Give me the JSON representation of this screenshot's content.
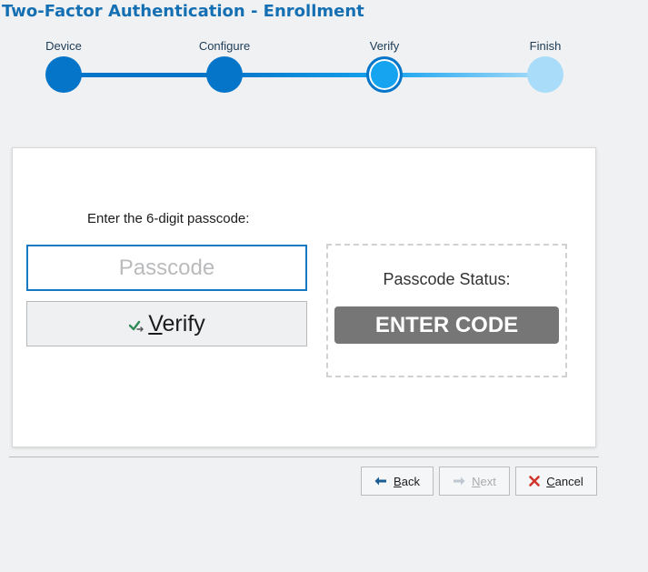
{
  "window": {
    "title": "Two-Factor Authentication - Enrollment"
  },
  "steps": [
    {
      "label": "Device",
      "state": "done"
    },
    {
      "label": "Configure",
      "state": "done"
    },
    {
      "label": "Verify",
      "state": "current"
    },
    {
      "label": "Finish",
      "state": "todo"
    }
  ],
  "form": {
    "prompt": "Enter the 6-digit passcode:",
    "passcode_value": "",
    "passcode_placeholder": "Passcode",
    "verify_icon": "check-arrow-icon",
    "verify_label_mnemonic": "V",
    "verify_label_rest": "erify"
  },
  "status": {
    "label": "Passcode Status:",
    "badge": "ENTER CODE",
    "badge_color": "#767676"
  },
  "footer": {
    "back": {
      "icon": "arrow-left-icon",
      "mnemonic": "B",
      "rest": "ack",
      "enabled": true
    },
    "next": {
      "icon": "arrow-right-icon",
      "mnemonic": "N",
      "rest": "ext",
      "enabled": false
    },
    "cancel": {
      "icon": "close-x-icon",
      "mnemonic": "C",
      "rest": "ancel",
      "enabled": true
    }
  },
  "colors": {
    "accent": "#1570b3",
    "step_done": "#0575c9",
    "step_current": "#16a3ef",
    "step_todo": "#a9dcf9",
    "cancel_icon": "#d0342c"
  }
}
